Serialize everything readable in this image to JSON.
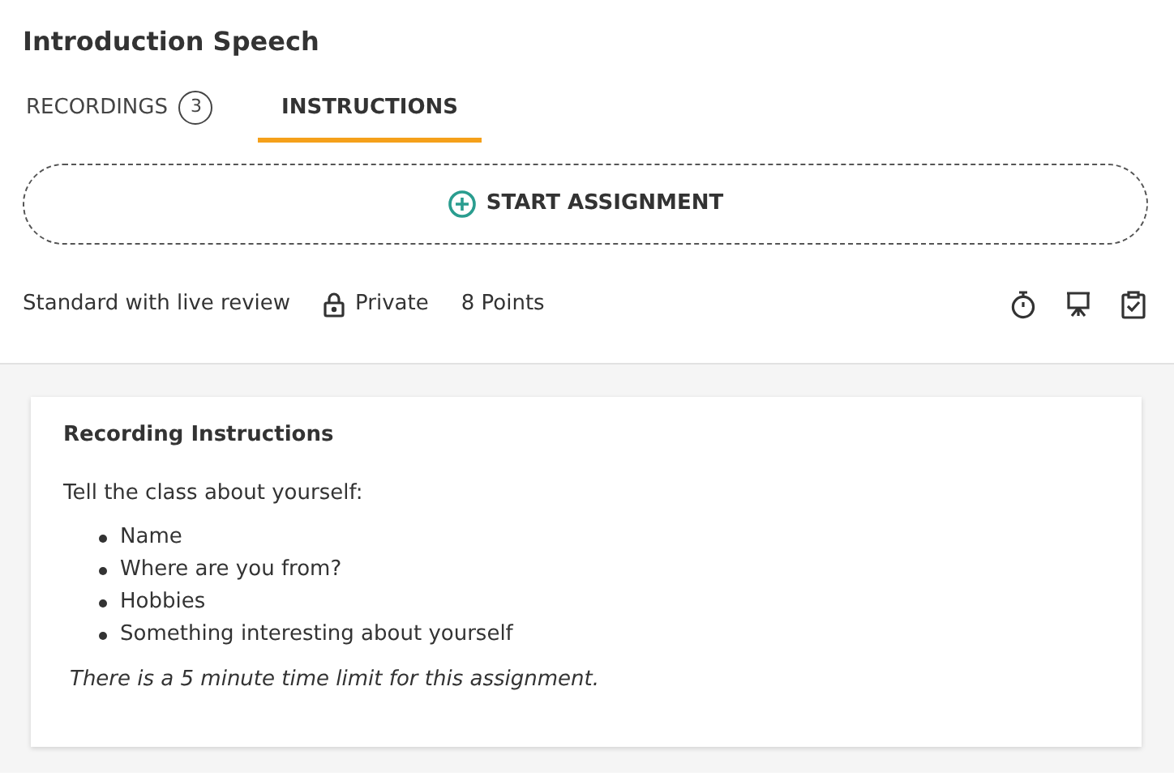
{
  "title": "Introduction Speech",
  "tabs": [
    {
      "label": "RECORDINGS",
      "count": "3",
      "selected": false
    },
    {
      "label": "INSTRUCTIONS",
      "selected": true
    }
  ],
  "start_button": {
    "label": "START ASSIGNMENT"
  },
  "meta": [
    {
      "kind": "text",
      "label": "Standard with live review"
    },
    {
      "kind": "lock",
      "label": "Private"
    },
    {
      "kind": "text",
      "label": "8 Points"
    }
  ],
  "tools": [
    {
      "kind": "timer"
    },
    {
      "kind": "presentation"
    },
    {
      "kind": "clipboard"
    }
  ],
  "instructions": {
    "heading": "Recording Instructions",
    "intro": "Tell the class about yourself:",
    "items": [
      "Name",
      "Where are you from?",
      "Hobbies",
      "Something interesting about yourself"
    ],
    "note": "There is a 5 minute time limit for this assignment."
  }
}
